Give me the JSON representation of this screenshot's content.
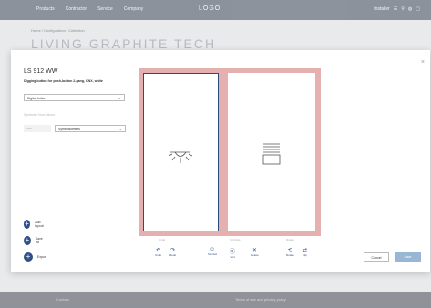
{
  "topbar": {
    "nav": [
      "Products",
      "Contractor",
      "Service",
      "Company"
    ],
    "logo": "LOGO",
    "right": [
      "Installer",
      "☰",
      "⚲",
      "◍",
      "▢"
    ]
  },
  "breadcrumb": "Home / Configuration / Collection",
  "background_title": "LIVING GRAPHITE TECH",
  "modal": {
    "close": "×",
    "product_name": "LS 912 WW",
    "product_subtitle": "Digging button for push-button 2-gang, KNX, white",
    "select1_value": "Digital button",
    "section_label": "Symbols / inscriptions",
    "smallbox_text": "Color",
    "select2_value": "Symbols/letters",
    "actions": [
      "Add layout",
      "Save list",
      "Export"
    ],
    "toolbar": {
      "groups": [
        "Undo",
        "Symbols",
        "Rotate"
      ],
      "buttons": [
        {
          "icon": "↶",
          "label": "Undo"
        },
        {
          "icon": "↷",
          "label": "Redo"
        },
        {
          "icon": "☺",
          "label": "Symbol"
        },
        {
          "icon": "ⓐ",
          "label": "Text"
        },
        {
          "icon": "✕",
          "label": "Delete"
        },
        {
          "icon": "⟲",
          "label": "Rotate"
        },
        {
          "icon": "⇄",
          "label": "Flip"
        }
      ]
    },
    "cancel_label": "Cancel",
    "save_label": "Save"
  },
  "footer": {
    "left": "Contact",
    "right": "Terms of use and privacy policy"
  },
  "colors": {
    "accent": "#2f4f86",
    "frame": "#e5b0b0"
  }
}
